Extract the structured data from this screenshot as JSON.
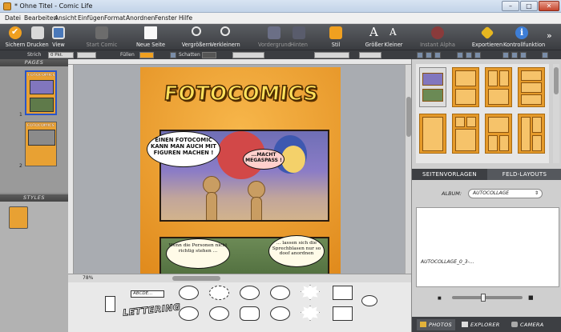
{
  "window": {
    "title": "* Ohne Titel - Comic Life",
    "min_glyph": "–",
    "max_glyph": "□",
    "close_glyph": "✕"
  },
  "menu": [
    "Datei",
    "Bearbeiten",
    "Ansicht",
    "Einfügen",
    "Format",
    "Anordnen",
    "Fenster",
    "Hilfe"
  ],
  "toolbar": [
    {
      "label": "Sichern",
      "icon": "checkmark-icon",
      "enabled": true
    },
    {
      "label": "Drucken",
      "icon": "printer-icon",
      "enabled": true
    },
    {
      "label": "View",
      "icon": "view-icon",
      "enabled": true
    },
    {
      "label": "Start Comic",
      "icon": "start-comic-icon",
      "enabled": false
    },
    {
      "label": "Neue Seite",
      "icon": "new-page-icon",
      "enabled": true
    },
    {
      "label": "Vergrößern",
      "icon": "zoom-in-icon",
      "enabled": true
    },
    {
      "label": "Verkleinern",
      "icon": "zoom-out-icon",
      "enabled": true
    },
    {
      "label": "Vordergrund",
      "icon": "bring-front-icon",
      "enabled": false
    },
    {
      "label": "Hinten",
      "icon": "send-back-icon",
      "enabled": false
    },
    {
      "label": "Stil",
      "icon": "style-icon",
      "enabled": true
    },
    {
      "label": "Größer",
      "icon": "text-bigger-icon",
      "enabled": true
    },
    {
      "label": "Kleiner",
      "icon": "text-smaller-icon",
      "enabled": true
    },
    {
      "label": "Instant Alpha",
      "icon": "instant-alpha-icon",
      "enabled": false
    },
    {
      "label": "Exportieren",
      "icon": "export-icon",
      "enabled": true
    },
    {
      "label": "Kontrollfunktion",
      "icon": "info-icon",
      "enabled": true
    }
  ],
  "toolbar_more": "»",
  "propbar": {
    "stroke_label": "Strich",
    "stroke_width": "0 Pkt.",
    "fill_label": "Füllen",
    "shadow_label": "Schatten",
    "fill_color": "#f0a020",
    "colors": {
      "shadow": "#555555"
    }
  },
  "left": {
    "pages_header": "PAGES",
    "styles_header": "STYLES",
    "pages": [
      {
        "number": "1",
        "title": "FOTOCOMICS"
      },
      {
        "number": "2",
        "title": "FOTOCOMICS"
      }
    ]
  },
  "page": {
    "title": "FOTOCOMICS",
    "bubbles": [
      "EINEN FOTOCOMIC KANN MAN AUCH MIT FIGUREN MACHEN !",
      "...MACHT MEGASPASS !",
      "Wenn die Personen nicht richtig stehen ...",
      "... lassen sich die Sprechblasen nur so doof anordnen"
    ]
  },
  "zoom": "78%",
  "palette": {
    "caption_text": "ABCDE...",
    "lettering_text": "LETTERING"
  },
  "right": {
    "tabs": [
      "SEITENVORLAGEN",
      "FELD-LAYOUTS"
    ],
    "active_tab": "FELD-LAYOUTS",
    "album_label": "ALBUM:",
    "album_value": "AUTOCOLLAGE",
    "album_arrow": "⇕",
    "photo_item": "AUTOCOLLAGE_0_3-...",
    "source_tabs": [
      {
        "label": "PHOTOS",
        "icon": "photos-icon"
      },
      {
        "label": "EXPLORER",
        "icon": "explorer-icon"
      },
      {
        "label": "CAMERA",
        "icon": "camera-icon"
      }
    ],
    "active_source": "PHOTOS"
  }
}
